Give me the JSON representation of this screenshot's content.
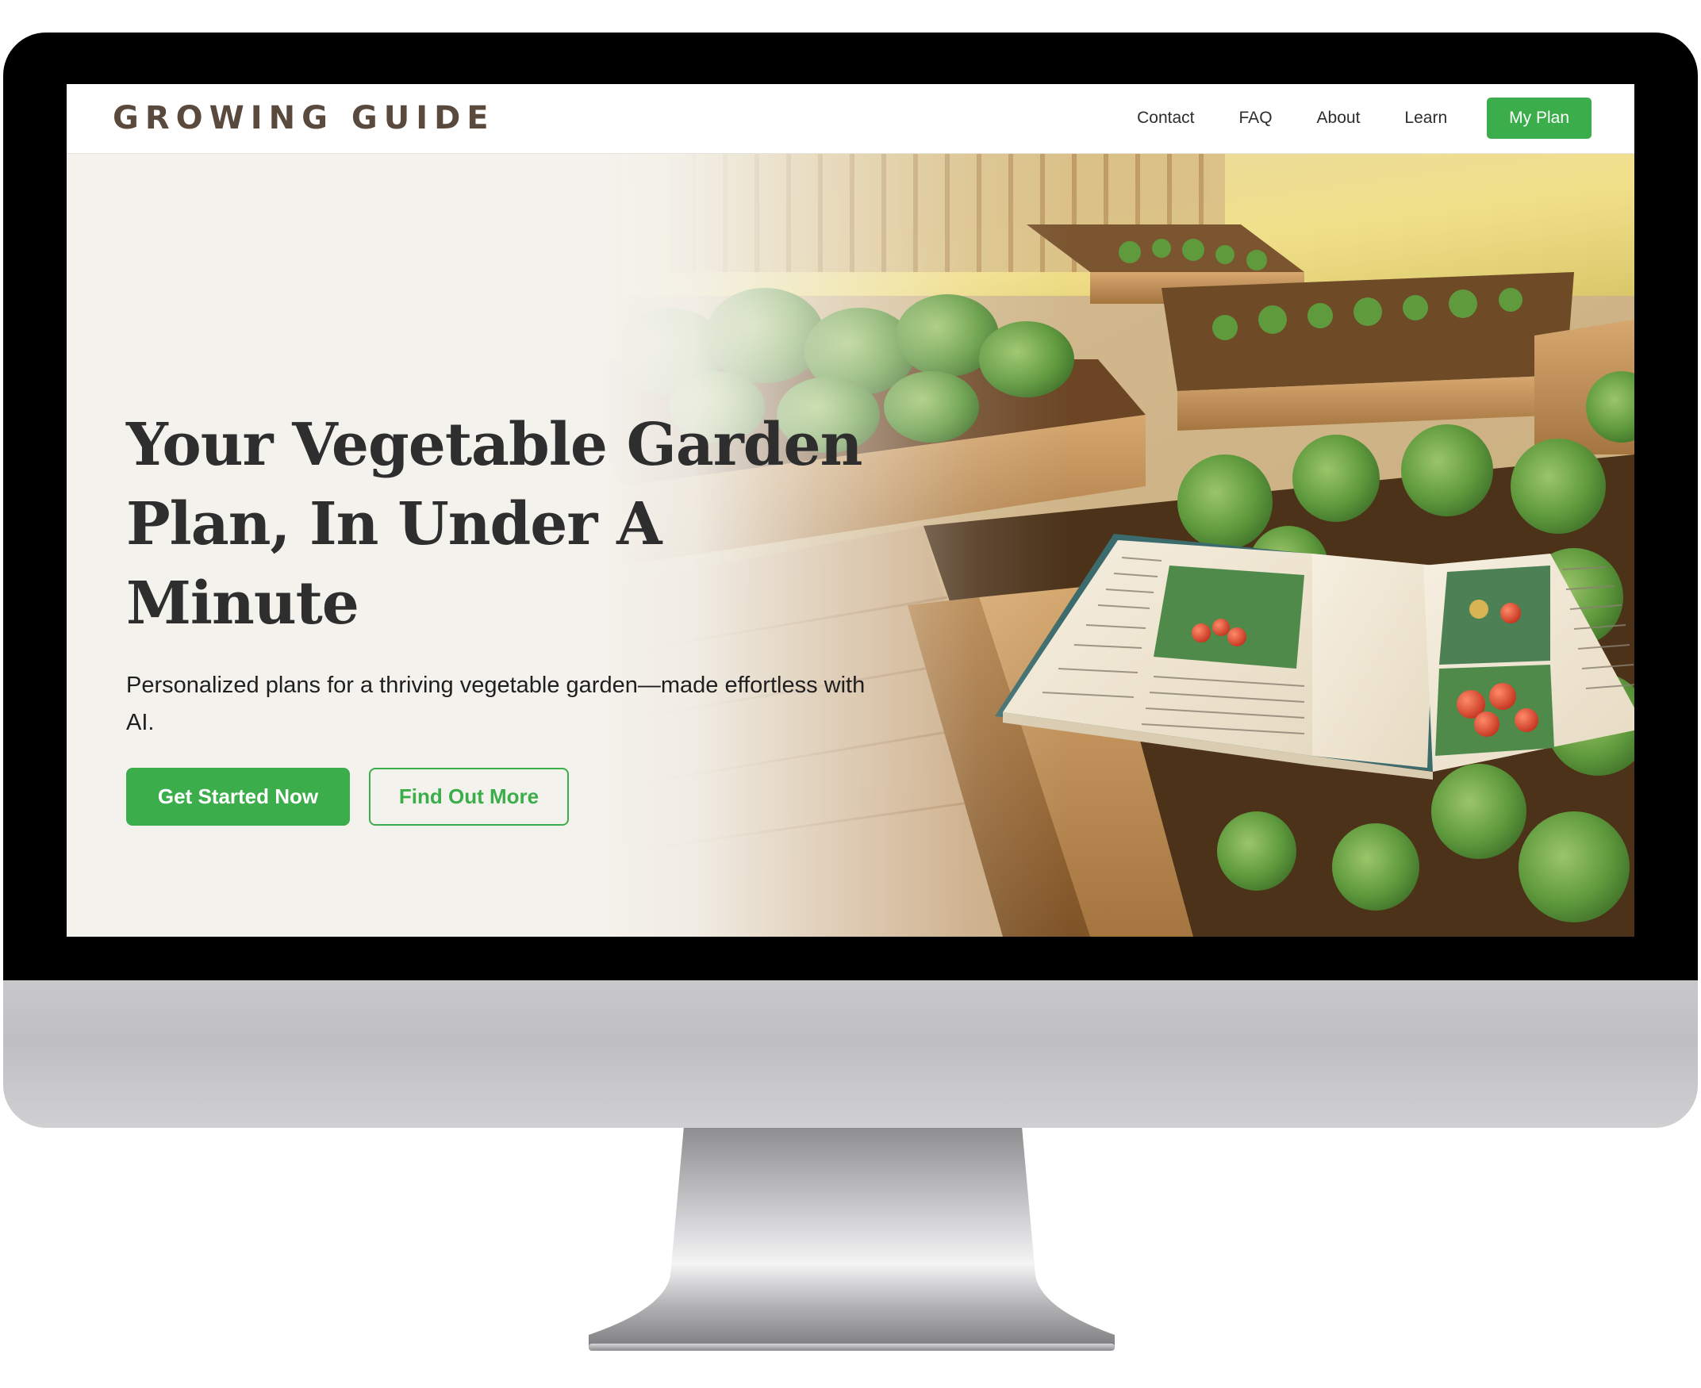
{
  "brand": {
    "logo_text": "GROWING GUIDE"
  },
  "nav": {
    "items": [
      {
        "label": "Contact"
      },
      {
        "label": "FAQ"
      },
      {
        "label": "About"
      },
      {
        "label": "Learn"
      }
    ],
    "cta_label": "My Plan"
  },
  "hero": {
    "title_line1": "Your Vegetable Garden",
    "title_line2": "Plan, In Under A Minute",
    "subtitle": "Personalized plans for a thriving vegetable garden—made effortless with AI.",
    "primary_button": "Get Started Now",
    "secondary_button": "Find Out More",
    "illustration": "raised-garden-beds-with-open-book-illustration"
  },
  "colors": {
    "accent": "#3bae4b",
    "logo": "#5a4a3e",
    "page_bg": "#f4f2ec",
    "heading": "#2e2e2e"
  }
}
